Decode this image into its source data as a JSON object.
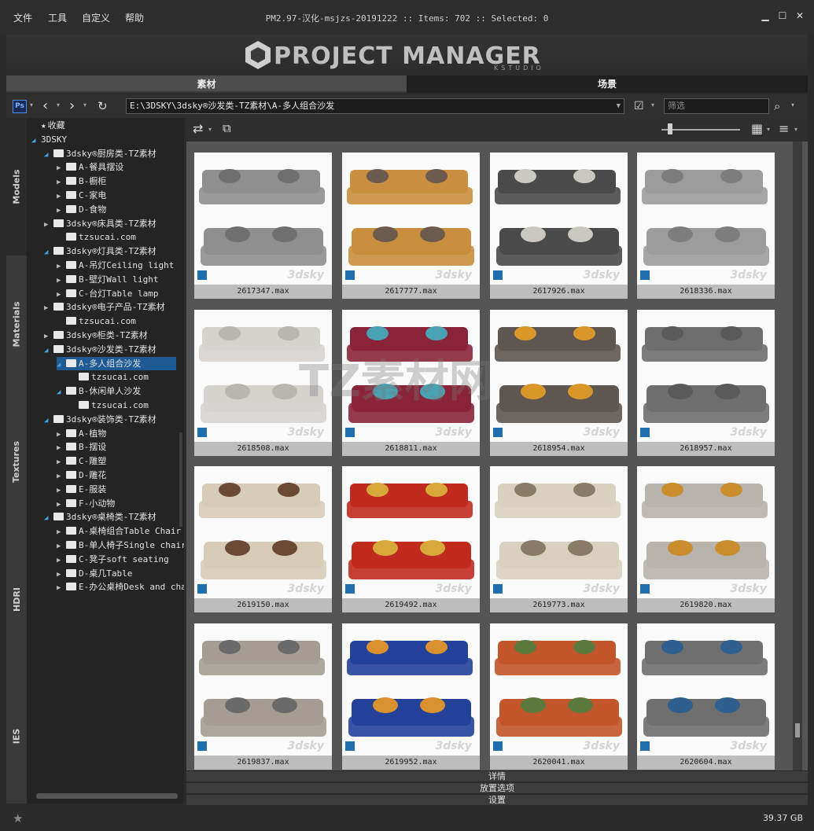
{
  "menu": {
    "file": "文件",
    "tools": "工具",
    "customize": "自定义",
    "help": "帮助"
  },
  "window": {
    "info": "PM2.97-汉化-msjzs-20191222  :: Items: 702  :: Selected: 0",
    "minimize": "▁",
    "maximize": "☐",
    "close": "✕"
  },
  "logo": {
    "title": "PROJECT MANAGER",
    "subtitle": "KSTUDIO"
  },
  "tabs": {
    "assets": "素材",
    "scenes": "场景"
  },
  "toolbar": {
    "ps_label": "Ps",
    "path": "E:\\3DSKY\\3dsky®沙发类-TZ素材\\A-多人组合沙发",
    "filter_placeholder": "筛选"
  },
  "side_tabs": [
    "Models",
    "Materials",
    "Textures",
    "HDRI",
    "IES"
  ],
  "tree": [
    {
      "label": "收藏",
      "indent": 0,
      "arrow": "",
      "icon": "star"
    },
    {
      "label": "3DSKY",
      "indent": 0,
      "arrow": "open",
      "icon": ""
    },
    {
      "label": "3dsky®厨房类-TZ素材",
      "indent": 1,
      "arrow": "open",
      "icon": "folder"
    },
    {
      "label": "A-餐具摆设",
      "indent": 2,
      "arrow": "closed",
      "icon": "folder"
    },
    {
      "label": "B-橱柜",
      "indent": 2,
      "arrow": "closed",
      "icon": "folder"
    },
    {
      "label": "C-家电",
      "indent": 2,
      "arrow": "closed",
      "icon": "folder"
    },
    {
      "label": "D-食物",
      "indent": 2,
      "arrow": "closed",
      "icon": "folder"
    },
    {
      "label": "3dsky®床具类-TZ素材",
      "indent": 1,
      "arrow": "closed",
      "icon": "folder"
    },
    {
      "label": "tzsucai.com",
      "indent": 2,
      "arrow": "",
      "icon": "folder"
    },
    {
      "label": "3dsky®灯具类-TZ素材",
      "indent": 1,
      "arrow": "open",
      "icon": "folder"
    },
    {
      "label": "A-吊灯Ceiling light",
      "indent": 2,
      "arrow": "closed",
      "icon": "folder"
    },
    {
      "label": "B-壁灯Wall light",
      "indent": 2,
      "arrow": "closed",
      "icon": "folder"
    },
    {
      "label": "C-台灯Table lamp",
      "indent": 2,
      "arrow": "closed",
      "icon": "folder"
    },
    {
      "label": "3dsky®电子产品-TZ素材",
      "indent": 1,
      "arrow": "closed",
      "icon": "folder"
    },
    {
      "label": "tzsucai.com",
      "indent": 2,
      "arrow": "",
      "icon": "folder"
    },
    {
      "label": "3dsky®柜类-TZ素材",
      "indent": 1,
      "arrow": "closed",
      "icon": "folder"
    },
    {
      "label": "3dsky®沙发类-TZ素材",
      "indent": 1,
      "arrow": "open",
      "icon": "folder"
    },
    {
      "label": "A-多人组合沙发",
      "indent": 2,
      "arrow": "open",
      "icon": "folder",
      "selected": true
    },
    {
      "label": "tzsucai.com",
      "indent": 3,
      "arrow": "",
      "icon": "folder"
    },
    {
      "label": "B-休闲单人沙发",
      "indent": 2,
      "arrow": "open",
      "icon": "folder"
    },
    {
      "label": "tzsucai.com",
      "indent": 3,
      "arrow": "",
      "icon": "folder"
    },
    {
      "label": "3dsky®装饰类-TZ素材",
      "indent": 1,
      "arrow": "open",
      "icon": "folder"
    },
    {
      "label": "A-植物",
      "indent": 2,
      "arrow": "closed",
      "icon": "folder"
    },
    {
      "label": "B-摆设",
      "indent": 2,
      "arrow": "closed",
      "icon": "folder"
    },
    {
      "label": "C-雕塑",
      "indent": 2,
      "arrow": "closed",
      "icon": "folder"
    },
    {
      "label": "D-雕花",
      "indent": 2,
      "arrow": "closed",
      "icon": "folder"
    },
    {
      "label": "E-服装",
      "indent": 2,
      "arrow": "closed",
      "icon": "folder"
    },
    {
      "label": "F-小动物",
      "indent": 2,
      "arrow": "closed",
      "icon": "folder"
    },
    {
      "label": "3dsky®桌椅类-TZ素材",
      "indent": 1,
      "arrow": "open",
      "icon": "folder"
    },
    {
      "label": "A-桌椅组合Table Chair",
      "indent": 2,
      "arrow": "closed",
      "icon": "folder"
    },
    {
      "label": "B-单人椅子Single chair",
      "indent": 2,
      "arrow": "closed",
      "icon": "folder"
    },
    {
      "label": "C-凳子soft seating",
      "indent": 2,
      "arrow": "closed",
      "icon": "folder"
    },
    {
      "label": "D-桌几Table",
      "indent": 2,
      "arrow": "closed",
      "icon": "folder"
    },
    {
      "label": "E-办公桌椅Desk and chair",
      "indent": 2,
      "arrow": "closed",
      "icon": "folder"
    }
  ],
  "items": [
    {
      "name": "2617347.max",
      "sofa": "#8f8f8f",
      "pillow": "#6f6f6f"
    },
    {
      "name": "2617777.max",
      "sofa": "#c98f3e",
      "pillow": "#6d5c4e"
    },
    {
      "name": "2617926.max",
      "sofa": "#4a4a4a",
      "pillow": "#c9c7bf"
    },
    {
      "name": "2618336.max",
      "sofa": "#9c9c9c",
      "pillow": "#7d7d7d"
    },
    {
      "name": "2618508.max",
      "sofa": "#d6d3cf",
      "pillow": "#b9b5b0"
    },
    {
      "name": "2618811.max",
      "sofa": "#8a2438",
      "pillow": "#4aa3b5"
    },
    {
      "name": "2618954.max",
      "sofa": "#5e5650",
      "pillow": "#d9972a"
    },
    {
      "name": "2618957.max",
      "sofa": "#6e6e6e",
      "pillow": "#5a5a5a"
    },
    {
      "name": "2619150.max",
      "sofa": "#d8ccb8",
      "pillow": "#6a4a35"
    },
    {
      "name": "2619492.max",
      "sofa": "#c12a1e",
      "pillow": "#d9a83a"
    },
    {
      "name": "2619773.max",
      "sofa": "#d9d1c0",
      "pillow": "#8a7b66"
    },
    {
      "name": "2619820.max",
      "sofa": "#b8b3ad",
      "pillow": "#c98d2e"
    },
    {
      "name": "2619837.max",
      "sofa": "#a59d93",
      "pillow": "#6a6a6a"
    },
    {
      "name": "2619952.max",
      "sofa": "#24419a",
      "pillow": "#d9902e"
    },
    {
      "name": "2620041.max",
      "sofa": "#c2562a",
      "pillow": "#5d7a3e"
    },
    {
      "name": "2620604.max",
      "sofa": "#6f6f6f",
      "pillow": "#2f5f8f"
    }
  ],
  "watermark": {
    "site": "3dsky",
    "overlay": "TZ素材网"
  },
  "panels": {
    "details": "详情",
    "placement": "放置选项",
    "settings": "设置"
  },
  "status": {
    "free_space": "39.37 GB"
  }
}
